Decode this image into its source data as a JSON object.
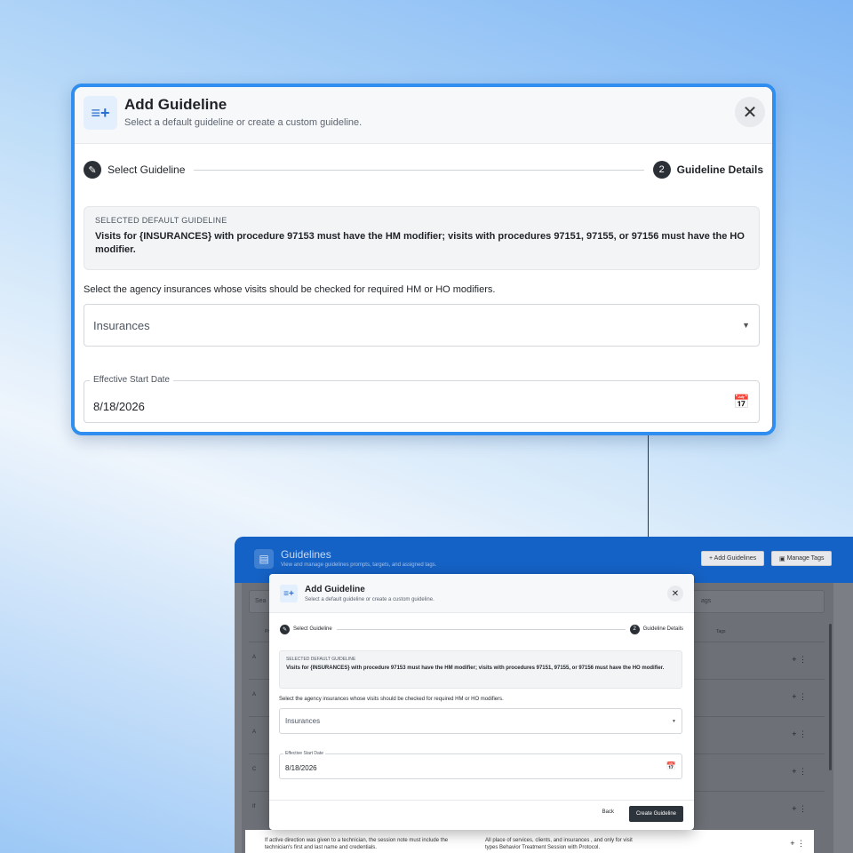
{
  "dialog": {
    "title": "Add Guideline",
    "subtitle": "Select a default guideline or create a custom guideline.",
    "close_glyph": "✕",
    "header_icon_glyph": "≡+",
    "steps": [
      {
        "icon": "✎",
        "label": "Select Guideline"
      },
      {
        "icon": "2",
        "label": "Guideline Details"
      }
    ],
    "selected_caption": "SELECTED DEFAULT GUIDELINE",
    "selected_text": "Visits for {INSURANCES} with procedure 97153 must have the HM modifier; visits with procedures 97151, 97155, or 97156 must have the HO modifier.",
    "instruction": "Select the agency insurances whose visits should be checked for required HM or HO modifiers.",
    "insurances_placeholder": "Insurances",
    "date_label": "Effective Start Date",
    "date_value": "8/18/2026",
    "back_label": "Back",
    "create_label": "Create Guideline"
  },
  "app": {
    "title": "Guidelines",
    "subtitle": "View and manage guidelines prompts, targets, and assigned tags.",
    "add_button": "+ Add Guidelines",
    "manage_button": "Manage Tags",
    "search_placeholder": "Sea",
    "tags_placeholder": "ags",
    "col_prompt": "Pr",
    "col_tags": "Tags",
    "rows": [
      "A",
      "A",
      "A",
      "C",
      "If"
    ],
    "row_actions": "+ ⋮",
    "last_row_prompt": "If active direction was given to a technician, the session note must include the technician's first and last name and credentials.",
    "last_row_target": "All place of services, clients, and insurances , and only for visit types Behavior Treatment Session with Protocol."
  },
  "colors": {
    "accent": "#2f8ef0",
    "appbar": "#1562c6",
    "primary_button": "#2e343c"
  },
  "icons": {
    "header": "playlist-add-icon",
    "close": "close-icon",
    "step1": "pencil-icon",
    "calendar": "calendar-icon",
    "dropdown": "chevron-down-icon"
  }
}
